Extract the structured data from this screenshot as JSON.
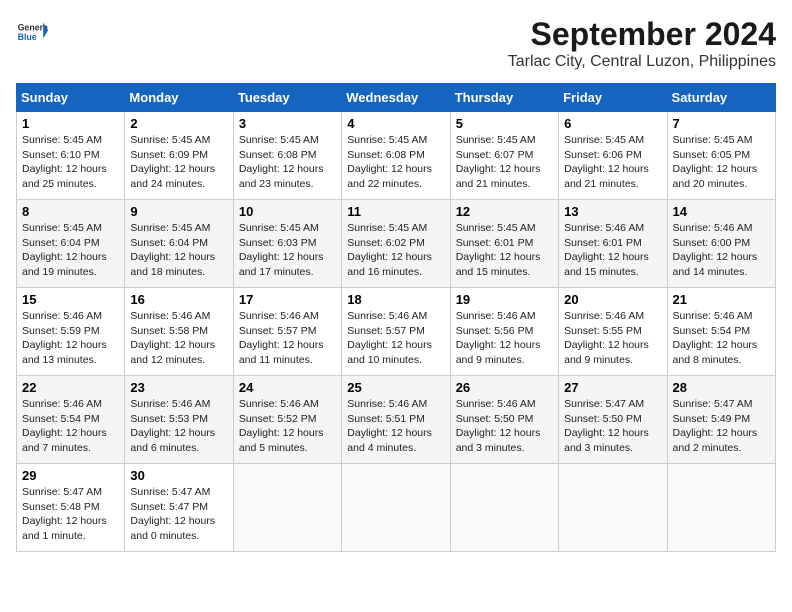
{
  "header": {
    "logo_line1": "General",
    "logo_line2": "Blue",
    "month": "September 2024",
    "location": "Tarlac City, Central Luzon, Philippines"
  },
  "weekdays": [
    "Sunday",
    "Monday",
    "Tuesday",
    "Wednesday",
    "Thursday",
    "Friday",
    "Saturday"
  ],
  "weeks": [
    [
      {
        "day": "1",
        "info": "Sunrise: 5:45 AM\nSunset: 6:10 PM\nDaylight: 12 hours\nand 25 minutes."
      },
      {
        "day": "2",
        "info": "Sunrise: 5:45 AM\nSunset: 6:09 PM\nDaylight: 12 hours\nand 24 minutes."
      },
      {
        "day": "3",
        "info": "Sunrise: 5:45 AM\nSunset: 6:08 PM\nDaylight: 12 hours\nand 23 minutes."
      },
      {
        "day": "4",
        "info": "Sunrise: 5:45 AM\nSunset: 6:08 PM\nDaylight: 12 hours\nand 22 minutes."
      },
      {
        "day": "5",
        "info": "Sunrise: 5:45 AM\nSunset: 6:07 PM\nDaylight: 12 hours\nand 21 minutes."
      },
      {
        "day": "6",
        "info": "Sunrise: 5:45 AM\nSunset: 6:06 PM\nDaylight: 12 hours\nand 21 minutes."
      },
      {
        "day": "7",
        "info": "Sunrise: 5:45 AM\nSunset: 6:05 PM\nDaylight: 12 hours\nand 20 minutes."
      }
    ],
    [
      {
        "day": "8",
        "info": "Sunrise: 5:45 AM\nSunset: 6:04 PM\nDaylight: 12 hours\nand 19 minutes."
      },
      {
        "day": "9",
        "info": "Sunrise: 5:45 AM\nSunset: 6:04 PM\nDaylight: 12 hours\nand 18 minutes."
      },
      {
        "day": "10",
        "info": "Sunrise: 5:45 AM\nSunset: 6:03 PM\nDaylight: 12 hours\nand 17 minutes."
      },
      {
        "day": "11",
        "info": "Sunrise: 5:45 AM\nSunset: 6:02 PM\nDaylight: 12 hours\nand 16 minutes."
      },
      {
        "day": "12",
        "info": "Sunrise: 5:45 AM\nSunset: 6:01 PM\nDaylight: 12 hours\nand 15 minutes."
      },
      {
        "day": "13",
        "info": "Sunrise: 5:46 AM\nSunset: 6:01 PM\nDaylight: 12 hours\nand 15 minutes."
      },
      {
        "day": "14",
        "info": "Sunrise: 5:46 AM\nSunset: 6:00 PM\nDaylight: 12 hours\nand 14 minutes."
      }
    ],
    [
      {
        "day": "15",
        "info": "Sunrise: 5:46 AM\nSunset: 5:59 PM\nDaylight: 12 hours\nand 13 minutes."
      },
      {
        "day": "16",
        "info": "Sunrise: 5:46 AM\nSunset: 5:58 PM\nDaylight: 12 hours\nand 12 minutes."
      },
      {
        "day": "17",
        "info": "Sunrise: 5:46 AM\nSunset: 5:57 PM\nDaylight: 12 hours\nand 11 minutes."
      },
      {
        "day": "18",
        "info": "Sunrise: 5:46 AM\nSunset: 5:57 PM\nDaylight: 12 hours\nand 10 minutes."
      },
      {
        "day": "19",
        "info": "Sunrise: 5:46 AM\nSunset: 5:56 PM\nDaylight: 12 hours\nand 9 minutes."
      },
      {
        "day": "20",
        "info": "Sunrise: 5:46 AM\nSunset: 5:55 PM\nDaylight: 12 hours\nand 9 minutes."
      },
      {
        "day": "21",
        "info": "Sunrise: 5:46 AM\nSunset: 5:54 PM\nDaylight: 12 hours\nand 8 minutes."
      }
    ],
    [
      {
        "day": "22",
        "info": "Sunrise: 5:46 AM\nSunset: 5:54 PM\nDaylight: 12 hours\nand 7 minutes."
      },
      {
        "day": "23",
        "info": "Sunrise: 5:46 AM\nSunset: 5:53 PM\nDaylight: 12 hours\nand 6 minutes."
      },
      {
        "day": "24",
        "info": "Sunrise: 5:46 AM\nSunset: 5:52 PM\nDaylight: 12 hours\nand 5 minutes."
      },
      {
        "day": "25",
        "info": "Sunrise: 5:46 AM\nSunset: 5:51 PM\nDaylight: 12 hours\nand 4 minutes."
      },
      {
        "day": "26",
        "info": "Sunrise: 5:46 AM\nSunset: 5:50 PM\nDaylight: 12 hours\nand 3 minutes."
      },
      {
        "day": "27",
        "info": "Sunrise: 5:47 AM\nSunset: 5:50 PM\nDaylight: 12 hours\nand 3 minutes."
      },
      {
        "day": "28",
        "info": "Sunrise: 5:47 AM\nSunset: 5:49 PM\nDaylight: 12 hours\nand 2 minutes."
      }
    ],
    [
      {
        "day": "29",
        "info": "Sunrise: 5:47 AM\nSunset: 5:48 PM\nDaylight: 12 hours\nand 1 minute."
      },
      {
        "day": "30",
        "info": "Sunrise: 5:47 AM\nSunset: 5:47 PM\nDaylight: 12 hours\nand 0 minutes."
      },
      {
        "day": "",
        "info": ""
      },
      {
        "day": "",
        "info": ""
      },
      {
        "day": "",
        "info": ""
      },
      {
        "day": "",
        "info": ""
      },
      {
        "day": "",
        "info": ""
      }
    ]
  ]
}
